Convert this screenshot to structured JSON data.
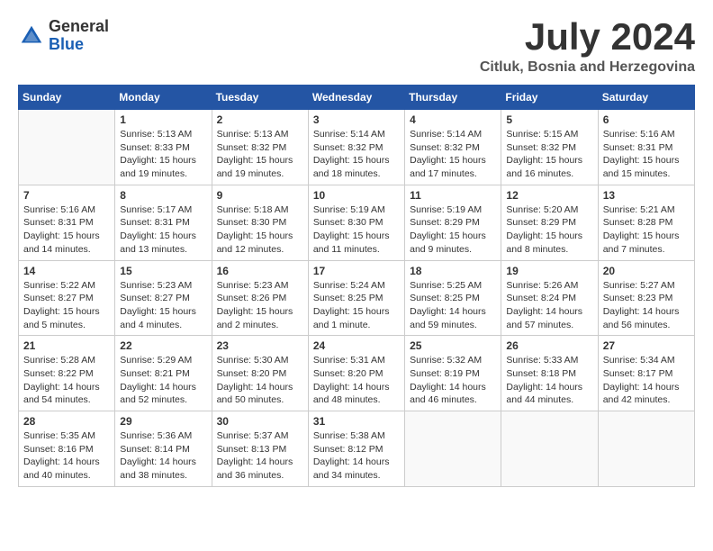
{
  "header": {
    "logo_general": "General",
    "logo_blue": "Blue",
    "month_year": "July 2024",
    "location": "Citluk, Bosnia and Herzegovina"
  },
  "weekdays": [
    "Sunday",
    "Monday",
    "Tuesday",
    "Wednesday",
    "Thursday",
    "Friday",
    "Saturday"
  ],
  "weeks": [
    [
      {
        "day": "",
        "info": ""
      },
      {
        "day": "1",
        "info": "Sunrise: 5:13 AM\nSunset: 8:33 PM\nDaylight: 15 hours\nand 19 minutes."
      },
      {
        "day": "2",
        "info": "Sunrise: 5:13 AM\nSunset: 8:32 PM\nDaylight: 15 hours\nand 19 minutes."
      },
      {
        "day": "3",
        "info": "Sunrise: 5:14 AM\nSunset: 8:32 PM\nDaylight: 15 hours\nand 18 minutes."
      },
      {
        "day": "4",
        "info": "Sunrise: 5:14 AM\nSunset: 8:32 PM\nDaylight: 15 hours\nand 17 minutes."
      },
      {
        "day": "5",
        "info": "Sunrise: 5:15 AM\nSunset: 8:32 PM\nDaylight: 15 hours\nand 16 minutes."
      },
      {
        "day": "6",
        "info": "Sunrise: 5:16 AM\nSunset: 8:31 PM\nDaylight: 15 hours\nand 15 minutes."
      }
    ],
    [
      {
        "day": "7",
        "info": "Sunrise: 5:16 AM\nSunset: 8:31 PM\nDaylight: 15 hours\nand 14 minutes."
      },
      {
        "day": "8",
        "info": "Sunrise: 5:17 AM\nSunset: 8:31 PM\nDaylight: 15 hours\nand 13 minutes."
      },
      {
        "day": "9",
        "info": "Sunrise: 5:18 AM\nSunset: 8:30 PM\nDaylight: 15 hours\nand 12 minutes."
      },
      {
        "day": "10",
        "info": "Sunrise: 5:19 AM\nSunset: 8:30 PM\nDaylight: 15 hours\nand 11 minutes."
      },
      {
        "day": "11",
        "info": "Sunrise: 5:19 AM\nSunset: 8:29 PM\nDaylight: 15 hours\nand 9 minutes."
      },
      {
        "day": "12",
        "info": "Sunrise: 5:20 AM\nSunset: 8:29 PM\nDaylight: 15 hours\nand 8 minutes."
      },
      {
        "day": "13",
        "info": "Sunrise: 5:21 AM\nSunset: 8:28 PM\nDaylight: 15 hours\nand 7 minutes."
      }
    ],
    [
      {
        "day": "14",
        "info": "Sunrise: 5:22 AM\nSunset: 8:27 PM\nDaylight: 15 hours\nand 5 minutes."
      },
      {
        "day": "15",
        "info": "Sunrise: 5:23 AM\nSunset: 8:27 PM\nDaylight: 15 hours\nand 4 minutes."
      },
      {
        "day": "16",
        "info": "Sunrise: 5:23 AM\nSunset: 8:26 PM\nDaylight: 15 hours\nand 2 minutes."
      },
      {
        "day": "17",
        "info": "Sunrise: 5:24 AM\nSunset: 8:25 PM\nDaylight: 15 hours\nand 1 minute."
      },
      {
        "day": "18",
        "info": "Sunrise: 5:25 AM\nSunset: 8:25 PM\nDaylight: 14 hours\nand 59 minutes."
      },
      {
        "day": "19",
        "info": "Sunrise: 5:26 AM\nSunset: 8:24 PM\nDaylight: 14 hours\nand 57 minutes."
      },
      {
        "day": "20",
        "info": "Sunrise: 5:27 AM\nSunset: 8:23 PM\nDaylight: 14 hours\nand 56 minutes."
      }
    ],
    [
      {
        "day": "21",
        "info": "Sunrise: 5:28 AM\nSunset: 8:22 PM\nDaylight: 14 hours\nand 54 minutes."
      },
      {
        "day": "22",
        "info": "Sunrise: 5:29 AM\nSunset: 8:21 PM\nDaylight: 14 hours\nand 52 minutes."
      },
      {
        "day": "23",
        "info": "Sunrise: 5:30 AM\nSunset: 8:20 PM\nDaylight: 14 hours\nand 50 minutes."
      },
      {
        "day": "24",
        "info": "Sunrise: 5:31 AM\nSunset: 8:20 PM\nDaylight: 14 hours\nand 48 minutes."
      },
      {
        "day": "25",
        "info": "Sunrise: 5:32 AM\nSunset: 8:19 PM\nDaylight: 14 hours\nand 46 minutes."
      },
      {
        "day": "26",
        "info": "Sunrise: 5:33 AM\nSunset: 8:18 PM\nDaylight: 14 hours\nand 44 minutes."
      },
      {
        "day": "27",
        "info": "Sunrise: 5:34 AM\nSunset: 8:17 PM\nDaylight: 14 hours\nand 42 minutes."
      }
    ],
    [
      {
        "day": "28",
        "info": "Sunrise: 5:35 AM\nSunset: 8:16 PM\nDaylight: 14 hours\nand 40 minutes."
      },
      {
        "day": "29",
        "info": "Sunrise: 5:36 AM\nSunset: 8:14 PM\nDaylight: 14 hours\nand 38 minutes."
      },
      {
        "day": "30",
        "info": "Sunrise: 5:37 AM\nSunset: 8:13 PM\nDaylight: 14 hours\nand 36 minutes."
      },
      {
        "day": "31",
        "info": "Sunrise: 5:38 AM\nSunset: 8:12 PM\nDaylight: 14 hours\nand 34 minutes."
      },
      {
        "day": "",
        "info": ""
      },
      {
        "day": "",
        "info": ""
      },
      {
        "day": "",
        "info": ""
      }
    ]
  ]
}
